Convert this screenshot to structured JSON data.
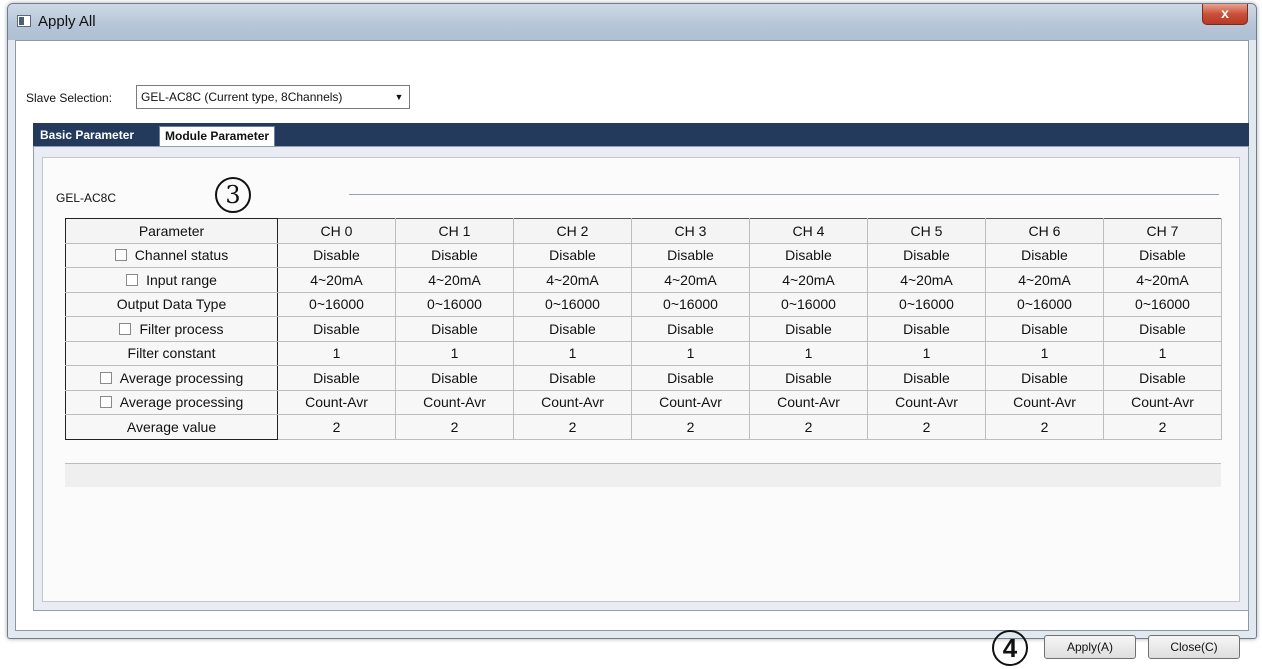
{
  "window": {
    "title": "Apply All",
    "close_glyph": "x"
  },
  "slave": {
    "label": "Slave Selection:",
    "selected": "GEL-AC8C (Current type, 8Channels)",
    "dropdown_icon": "chevron-down-icon"
  },
  "tabs": [
    {
      "label": "Basic Parameter",
      "active": false
    },
    {
      "label": "Module Parameter",
      "active": true
    }
  ],
  "group": {
    "label": "GEL-AC8C",
    "marker": "3"
  },
  "table": {
    "columns": [
      "Parameter",
      "CH 0",
      "CH 1",
      "CH 2",
      "CH 3",
      "CH 4",
      "CH 5",
      "CH 6",
      "CH 7"
    ],
    "rows": [
      {
        "label": "Channel status",
        "checkbox": true,
        "values": [
          "Disable",
          "Disable",
          "Disable",
          "Disable",
          "Disable",
          "Disable",
          "Disable",
          "Disable"
        ]
      },
      {
        "label": "Input range",
        "checkbox": true,
        "values": [
          "4~20mA",
          "4~20mA",
          "4~20mA",
          "4~20mA",
          "4~20mA",
          "4~20mA",
          "4~20mA",
          "4~20mA"
        ]
      },
      {
        "label": "Output Data Type",
        "checkbox": false,
        "values": [
          "0~16000",
          "0~16000",
          "0~16000",
          "0~16000",
          "0~16000",
          "0~16000",
          "0~16000",
          "0~16000"
        ]
      },
      {
        "label": "Filter process",
        "checkbox": true,
        "values": [
          "Disable",
          "Disable",
          "Disable",
          "Disable",
          "Disable",
          "Disable",
          "Disable",
          "Disable"
        ]
      },
      {
        "label": "Filter constant",
        "checkbox": false,
        "values": [
          "1",
          "1",
          "1",
          "1",
          "1",
          "1",
          "1",
          "1"
        ]
      },
      {
        "label": "Average processing",
        "checkbox": true,
        "values": [
          "Disable",
          "Disable",
          "Disable",
          "Disable",
          "Disable",
          "Disable",
          "Disable",
          "Disable"
        ]
      },
      {
        "label": "Average processing",
        "checkbox": true,
        "values": [
          "Count-Avr",
          "Count-Avr",
          "Count-Avr",
          "Count-Avr",
          "Count-Avr",
          "Count-Avr",
          "Count-Avr",
          "Count-Avr"
        ]
      },
      {
        "label": "Average value",
        "checkbox": false,
        "values": [
          "2",
          "2",
          "2",
          "2",
          "2",
          "2",
          "2",
          "2"
        ]
      }
    ]
  },
  "footer": {
    "marker": "4",
    "apply_label": "Apply(A)",
    "close_label": "Close(C)"
  }
}
